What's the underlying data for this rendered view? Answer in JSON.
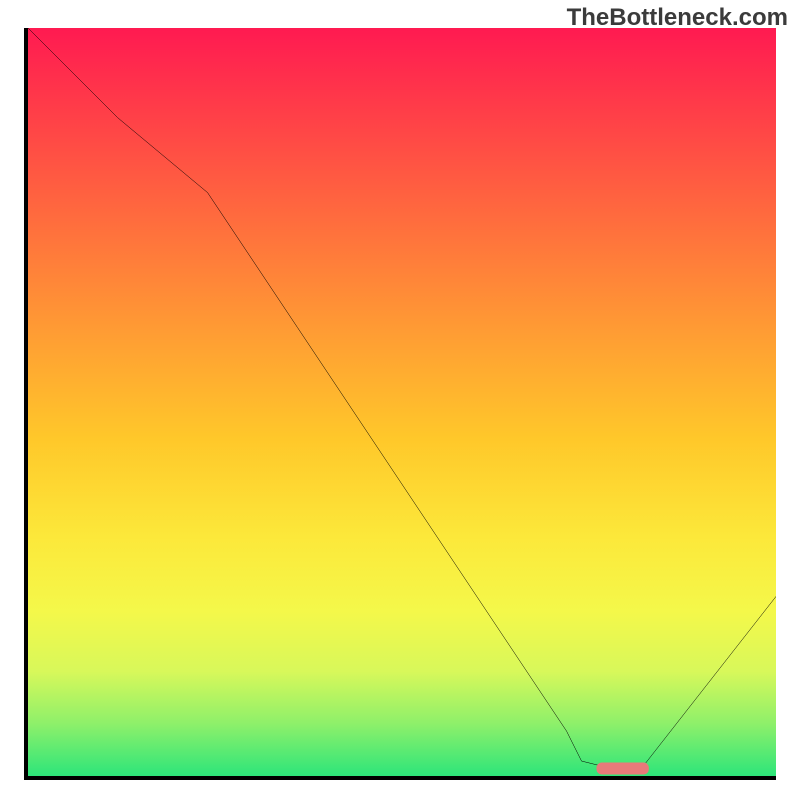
{
  "watermark": "TheBottleneck.com",
  "chart_data": {
    "type": "line",
    "title": "",
    "xlabel": "",
    "ylabel": "",
    "xlim": [
      0,
      100
    ],
    "ylim": [
      0,
      100
    ],
    "grid": false,
    "series": [
      {
        "name": "curve",
        "x": [
          0,
          12,
          24,
          36,
          48,
          60,
          72,
          74,
          78,
          82,
          100
        ],
        "values": [
          100,
          88,
          78,
          60,
          42,
          24,
          6,
          2,
          1,
          1,
          24
        ]
      }
    ],
    "marker": {
      "name": "minimum-band",
      "x_range": [
        76,
        83
      ],
      "y": 1,
      "color": "#e87a7a"
    }
  }
}
